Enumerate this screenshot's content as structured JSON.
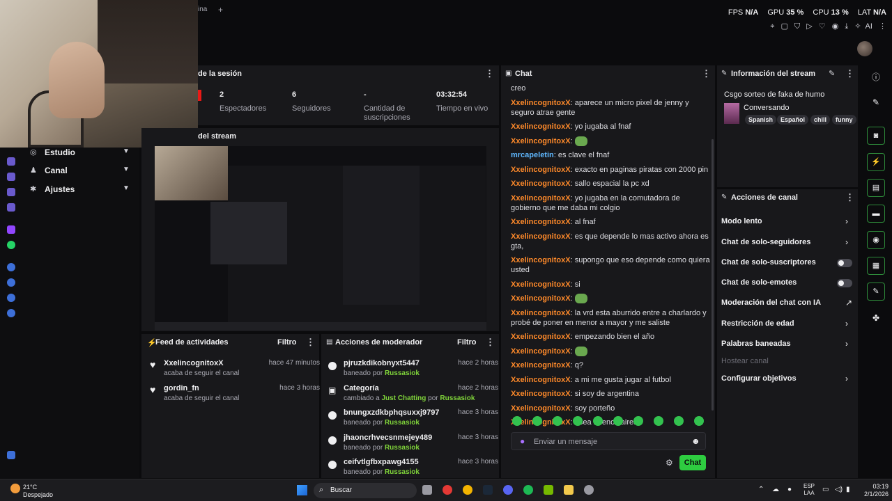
{
  "topbar": {
    "tab_fragment": "ina",
    "new_tab": "+",
    "stats": [
      {
        "label": "FPS",
        "value": "N/A"
      },
      {
        "label": "GPU",
        "value": "35 %"
      },
      {
        "label": "CPU",
        "value": "13 %"
      },
      {
        "label": "LAT",
        "value": "N/A"
      }
    ],
    "ai_label": "AI"
  },
  "left_nav": {
    "items": [
      {
        "label": "Estudio",
        "icon": "studio-icon"
      },
      {
        "label": "Canal",
        "icon": "people-icon"
      },
      {
        "label": "Ajustes",
        "icon": "gear-icon"
      }
    ]
  },
  "session": {
    "title": "de la sesión",
    "cells": [
      {
        "value": "2",
        "label": "Espectadores"
      },
      {
        "value": "6",
        "label": "Seguidores"
      },
      {
        "value": "-",
        "label": "Cantidad de suscripciones"
      },
      {
        "value": "03:32:54",
        "label": "Tiempo en vivo"
      }
    ]
  },
  "preview": {
    "title": "del stream"
  },
  "activity_feed": {
    "title": "Feed de actividades",
    "filter": "Filtro",
    "items": [
      {
        "name": "XxelincognitoxX",
        "sub": "acaba de seguir el canal",
        "time": "hace 47 minutos"
      },
      {
        "name": "gordin_fn",
        "sub": "acaba de seguir el canal",
        "time": "hace 3 horas"
      }
    ]
  },
  "mod_actions": {
    "title": "Acciones de moderador",
    "filter": "Filtro",
    "items": [
      {
        "name": "pjruzkdikobnyxt5447",
        "action": "baneado por",
        "extra": "",
        "by_word": "",
        "by": "Russasiok",
        "time": "hace 2 horas"
      },
      {
        "name": "Categoría",
        "action": "cambiado a",
        "extra": "Just Chatting",
        "by_word": "por",
        "by": "Russasiok",
        "time": "hace 2 horas"
      },
      {
        "name": "bnungxzdkbphqsuxxj9797",
        "action": "baneado por",
        "extra": "",
        "by_word": "",
        "by": "Russasiok",
        "time": "hace 3 horas"
      },
      {
        "name": "jhaoncrhvecsnmejey489",
        "action": "baneado por",
        "extra": "",
        "by_word": "",
        "by": "Russasiok",
        "time": "hace 3 horas"
      },
      {
        "name": "ceifvtlgfbxpawg4155",
        "action": "baneado por",
        "extra": "",
        "by_word": "",
        "by": "Russasiok",
        "time": "hace 3 horas"
      }
    ]
  },
  "chat": {
    "title": "Chat",
    "messages": [
      {
        "user": "",
        "text": "creo"
      },
      {
        "user": "XxelincognitoxX",
        "text": "aparece un micro pixel de jenny y seguro atrae gente"
      },
      {
        "user": "XxelincognitoxX",
        "text": "yo jugaba al fnaf"
      },
      {
        "user": "XxelincognitoxX",
        "text": "",
        "emote": true
      },
      {
        "user": "mrcapeletin",
        "text": "es clave el fnaf",
        "cap": true
      },
      {
        "user": "XxelincognitoxX",
        "text": "exacto en paginas piratas con 2000 pin"
      },
      {
        "user": "XxelincognitoxX",
        "text": "sallo espacial la pc xd"
      },
      {
        "user": "XxelincognitoxX",
        "text": "yo jugaba en la comutadora de gobierno que me daba mi colgio"
      },
      {
        "user": "XxelincognitoxX",
        "text": "al fnaf"
      },
      {
        "user": "XxelincognitoxX",
        "text": "es que depende lo mas activo ahora es gta,"
      },
      {
        "user": "XxelincognitoxX",
        "text": "supongo que eso depende como quiera usted"
      },
      {
        "user": "XxelincognitoxX",
        "text": "si"
      },
      {
        "user": "XxelincognitoxX",
        "text": "",
        "emote": true
      },
      {
        "user": "XxelincognitoxX",
        "text": "la vrd esta aburrido entre a charlardo y probé de poner en menor a mayor y me saliste"
      },
      {
        "user": "XxelincognitoxX",
        "text": "empezando bien el año"
      },
      {
        "user": "XxelincognitoxX",
        "text": "",
        "emote": true
      },
      {
        "user": "XxelincognitoxX",
        "text": "q?"
      },
      {
        "user": "XxelincognitoxX",
        "text": "a mi me gusta jugar al futbol"
      },
      {
        "user": "XxelincognitoxX",
        "text": "si soy de argentina"
      },
      {
        "user": "XxelincognitoxX",
        "text": "soy porteño"
      },
      {
        "user": "XxelincognitoxX",
        "text": "osea buenos aires"
      }
    ],
    "input_placeholder": "Enviar un mensaje",
    "send_label": "Chat"
  },
  "stream_info": {
    "title": "Información del stream",
    "stream_title": "Csgo sorteo de faka de humo",
    "category": "Conversando",
    "tags": [
      "Spanish",
      "Español",
      "chill",
      "funny"
    ]
  },
  "channel_actions": {
    "title": "Acciones de canal",
    "items": [
      {
        "label": "Modo lento",
        "kind": "chevron"
      },
      {
        "label": "Chat de solo-seguidores",
        "kind": "chevron"
      },
      {
        "label": "Chat de solo-suscriptores",
        "kind": "toggle"
      },
      {
        "label": "Chat de solo-emotes",
        "kind": "toggle"
      },
      {
        "label": "Moderación del chat con IA",
        "kind": "external"
      },
      {
        "label": "Restricción de edad",
        "kind": "chevron"
      },
      {
        "label": "Palabras baneadas",
        "kind": "chevron"
      },
      {
        "label": "Hostear canal",
        "kind": "disabled"
      },
      {
        "label": "Configurar objetivos",
        "kind": "chevron"
      }
    ]
  },
  "taskbar": {
    "temperature": "21°C",
    "weather": "Despejado",
    "search_label": "Buscar",
    "lang_top": "ESP",
    "lang_bottom": "LAA",
    "time": "03:19",
    "date": "2/1/2026"
  },
  "colors": {
    "accent_green": "#2ecc40",
    "username_orange": "#ff8a2a",
    "username_blue": "#5fb8ff",
    "panel_bg": "#18181b"
  }
}
